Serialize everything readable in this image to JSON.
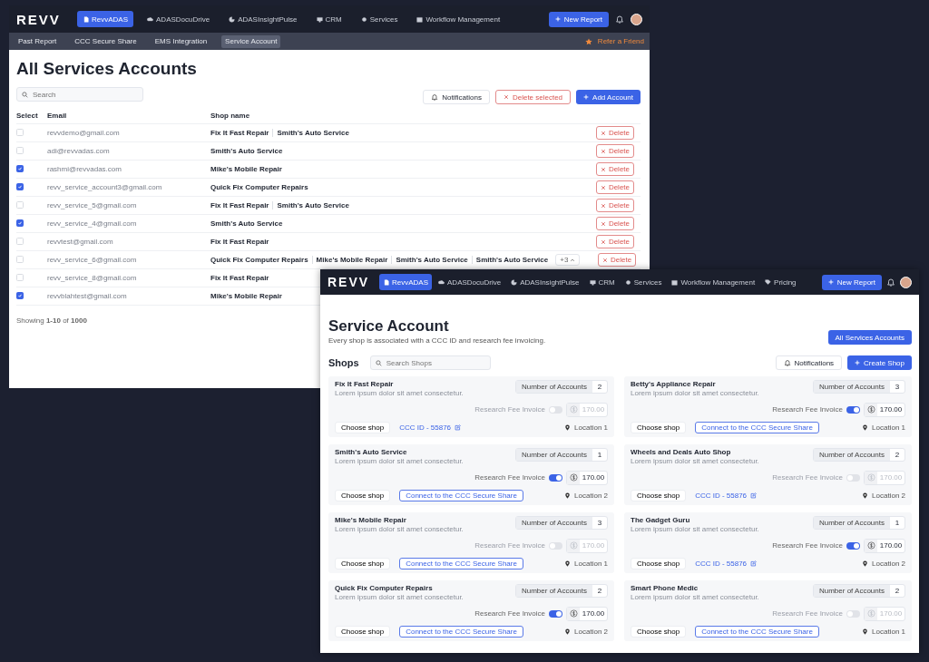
{
  "back_window": {
    "logo": "REVV",
    "nav": [
      {
        "label": "RevvADAS",
        "selected": true
      },
      {
        "label": "ADASDocuDrive",
        "selected": false
      },
      {
        "label": "ADASInsightPulse",
        "selected": false
      },
      {
        "label": "CRM",
        "selected": false
      },
      {
        "label": "Services",
        "selected": false
      },
      {
        "label": "Workflow Management",
        "selected": false
      }
    ],
    "new_report": "New Report",
    "subnav": [
      {
        "label": "Past Report",
        "selected": false
      },
      {
        "label": "CCC Secure Share",
        "selected": false
      },
      {
        "label": "EMS Integration",
        "selected": false
      },
      {
        "label": "Service Account",
        "selected": true
      }
    ],
    "refer": "Refer a Friend",
    "title": "All Services Accounts",
    "search": {
      "placeholder": "Search"
    },
    "buttons": {
      "notifications": "Notifications",
      "delete_selected": "Delete selected",
      "add": "Add Account"
    },
    "table": {
      "columns": [
        "Select",
        "Email",
        "Shop name"
      ],
      "rows": [
        {
          "email": "revvdemo@gmail.com",
          "shops": [
            "Fix It Fast Repair",
            "Smith's Auto Service"
          ],
          "selected": false,
          "delete": "Delete"
        },
        {
          "email": "adi@revvadas.com",
          "shops": [
            "Smith's Auto Service"
          ],
          "selected": false,
          "delete": "Delete"
        },
        {
          "email": "rashmi@revvadas.com",
          "shops": [
            "Mike's Mobile Repair"
          ],
          "selected": true,
          "delete": "Delete"
        },
        {
          "email": "revv_service_account3@gmail.com",
          "shops": [
            "Quick Fix Computer Repairs"
          ],
          "selected": true,
          "delete": "Delete"
        },
        {
          "email": "revv_service_5@gmail.com",
          "shops": [
            "Fix It Fast Repair",
            "Smith's Auto Service"
          ],
          "selected": false,
          "delete": "Delete"
        },
        {
          "email": "revv_service_4@gmail.com",
          "shops": [
            "Smith's Auto Service"
          ],
          "selected": true,
          "delete": "Delete"
        },
        {
          "email": "revvtest@gmail.com",
          "shops": [
            "Fix It Fast Repair"
          ],
          "selected": false,
          "delete": "Delete"
        },
        {
          "email": "revv_service_6@gmail.com",
          "shops": [
            "Quick Fix Computer Repairs",
            "Mike's Mobile Repair",
            "Smith's Auto Service",
            "Smith's Auto Service"
          ],
          "more": "+3",
          "selected": false,
          "delete": "Delete"
        },
        {
          "email": "revv_service_8@gmail.com",
          "shops": [
            "Fix It Fast Repair"
          ],
          "selected": false
        },
        {
          "email": "revvblahtest@gmail.com",
          "shops": [
            "Mike's Mobile Repair"
          ],
          "selected": true
        }
      ]
    },
    "footer": "Showing **1-10** of **1000**"
  },
  "front_window": {
    "logo": "REVV",
    "nav": [
      {
        "label": "RevvADAS",
        "selected": true
      },
      {
        "label": "ADASDocuDrive",
        "selected": false
      },
      {
        "label": "ADASInsightPulse",
        "selected": false
      },
      {
        "label": "CRM",
        "selected": false
      },
      {
        "label": "Services",
        "selected": false
      },
      {
        "label": "Workflow Management",
        "selected": false
      },
      {
        "label": "Pricing",
        "selected": false
      }
    ],
    "new_report": "New Report",
    "title": "Service Account",
    "subtitle": "Every shop is associated with a CCC ID and research fee invoicing.",
    "all_accounts": "All Services Accounts",
    "shops_heading": "Shops",
    "search": {
      "placeholder": "Search Shops"
    },
    "notifications": "Notifications",
    "create": "Create Shop",
    "shops": [
      {
        "name": "Fix It Fast Repair",
        "description": "Lorem ipsum dolor sit amet consectetur.",
        "accounts_label": "Number of Accounts",
        "accounts": "2",
        "fee_label": "Research Fee Invoice",
        "fee_on": false,
        "amount": "170.00",
        "choose": "Choose shop",
        "ccc": {
          "kind": "link",
          "text": "CCC ID - 55876"
        },
        "location": "Location 1"
      },
      {
        "name": "Betty's Appliance Repair",
        "description": "Lorem ipsum dolor sit amet consectetur.",
        "accounts_label": "Number of Accounts",
        "accounts": "3",
        "fee_label": "Research Fee Invoice",
        "fee_on": true,
        "amount": "170.00",
        "choose": "Choose shop",
        "ccc": {
          "kind": "button",
          "text": "Connect to the CCC Secure Share"
        },
        "location": "Location 1"
      },
      {
        "name": "Smith's Auto Service",
        "description": "Lorem ipsum dolor sit amet consectetur.",
        "accounts_label": "Number of Accounts",
        "accounts": "1",
        "fee_label": "Research Fee Invoice",
        "fee_on": true,
        "amount": "170.00",
        "choose": "Choose shop",
        "ccc": {
          "kind": "button",
          "text": "Connect to the CCC Secure Share"
        },
        "location": "Location 2"
      },
      {
        "name": "Wheels and Deals Auto Shop",
        "description": "Lorem ipsum dolor sit amet consectetur.",
        "accounts_label": "Number of Accounts",
        "accounts": "2",
        "fee_label": "Research Fee Invoice",
        "fee_on": false,
        "amount": "170.00",
        "choose": "Choose shop",
        "ccc": {
          "kind": "link",
          "text": "CCC ID - 55876"
        },
        "location": "Location 2"
      },
      {
        "name": "Mike's Mobile Repair",
        "description": "Lorem ipsum dolor sit amet consectetur.",
        "accounts_label": "Number of Accounts",
        "accounts": "3",
        "fee_label": "Research Fee Invoice",
        "fee_on": false,
        "amount": "170.00",
        "choose": "Choose shop",
        "ccc": {
          "kind": "button",
          "text": "Connect to the CCC Secure Share"
        },
        "location": "Location 1"
      },
      {
        "name": "The Gadget Guru",
        "description": "Lorem ipsum dolor sit amet consectetur.",
        "accounts_label": "Number of Accounts",
        "accounts": "1",
        "fee_label": "Research Fee Invoice",
        "fee_on": true,
        "amount": "170.00",
        "choose": "Choose shop",
        "ccc": {
          "kind": "link",
          "text": "CCC ID - 55876"
        },
        "location": "Location 2"
      },
      {
        "name": "Quick Fix Computer Repairs",
        "description": "Lorem ipsum dolor sit amet consectetur.",
        "accounts_label": "Number of Accounts",
        "accounts": "2",
        "fee_label": "Research Fee Invoice",
        "fee_on": true,
        "amount": "170.00",
        "choose": "Choose shop",
        "ccc": {
          "kind": "button",
          "text": "Connect to the CCC Secure Share"
        },
        "location": "Location 2"
      },
      {
        "name": "Smart Phone Medic",
        "description": "Lorem ipsum dolor sit amet consectetur.",
        "accounts_label": "Number of Accounts",
        "accounts": "2",
        "fee_label": "Research Fee Invoice",
        "fee_on": false,
        "amount": "170.00",
        "choose": "Choose shop",
        "ccc": {
          "kind": "button",
          "text": "Connect to the CCC Secure Share"
        },
        "location": "Location 1"
      }
    ]
  }
}
